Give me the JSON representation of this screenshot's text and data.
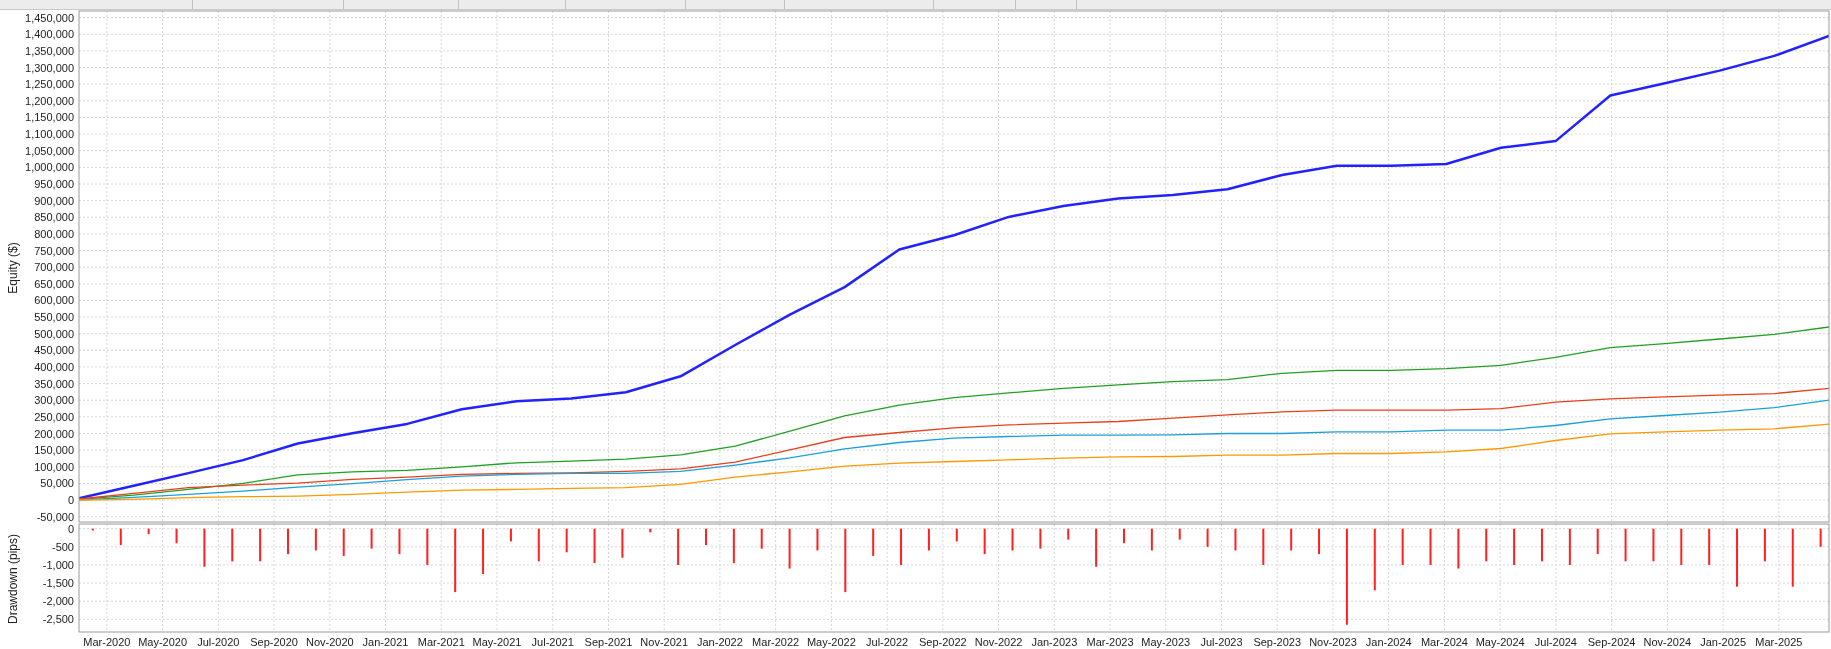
{
  "equity_chart": {
    "chart_data": {
      "type": "line",
      "ylabel": "Equity ($)",
      "categories": [
        null,
        null,
        null,
        null,
        null,
        null,
        null,
        null,
        null,
        null,
        null,
        null,
        null,
        null,
        null,
        null,
        null,
        null,
        null,
        null,
        null,
        null,
        null,
        null,
        null,
        null,
        null,
        null,
        null,
        null,
        null,
        null,
        null
      ],
      "ylim": [
        -66000,
        1470000
      ],
      "grid": true,
      "yticks": [
        {
          "value": 1450000,
          "label": "1,450,000"
        },
        {
          "value": 1400000,
          "label": "1,400,000"
        },
        {
          "value": 1350000,
          "label": "1,350,000"
        },
        {
          "value": 1300000,
          "label": "1,300,000"
        },
        {
          "value": 1250000,
          "label": "1,250,000"
        },
        {
          "value": 1200000,
          "label": "1,200,000"
        },
        {
          "value": 1150000,
          "label": "1,150,000"
        },
        {
          "value": 1100000,
          "label": "1,100,000"
        },
        {
          "value": 1050000,
          "label": "1,050,000"
        },
        {
          "value": 1000000,
          "label": "1,000,000"
        },
        {
          "value": 950000,
          "label": "950,000"
        },
        {
          "value": 900000,
          "label": "900,000"
        },
        {
          "value": 850000,
          "label": "850,000"
        },
        {
          "value": 800000,
          "label": "800,000"
        },
        {
          "value": 750000,
          "label": "750,000"
        },
        {
          "value": 700000,
          "label": "700,000"
        },
        {
          "value": 650000,
          "label": "650,000"
        },
        {
          "value": 600000,
          "label": "600,000"
        },
        {
          "value": 550000,
          "label": "550,000"
        },
        {
          "value": 500000,
          "label": "500,000"
        },
        {
          "value": 450000,
          "label": "450,000"
        },
        {
          "value": 400000,
          "label": "400,000"
        },
        {
          "value": 350000,
          "label": "350,000"
        },
        {
          "value": 300000,
          "label": "300,000"
        },
        {
          "value": 250000,
          "label": "250,000"
        },
        {
          "value": 200000,
          "label": "200,000"
        },
        {
          "value": 150000,
          "label": "150,000"
        },
        {
          "value": 100000,
          "label": "100,000"
        },
        {
          "value": 50000,
          "label": "50,000"
        },
        {
          "value": 0,
          "label": "0"
        },
        {
          "value": -50000,
          "label": "-50,000"
        }
      ],
      "series": [
        {
          "color": "#2222ff",
          "values": [
            5000,
            43000,
            81000,
            120000,
            170000,
            201000,
            229000,
            273000,
            297000,
            305000,
            324000,
            372000,
            466000,
            557000,
            640000,
            753000,
            796000,
            851000,
            884000,
            906000,
            917000,
            934000,
            977000,
            1005000,
            1005000,
            1010000,
            1059000,
            1079000,
            1216000,
            1253000,
            1291000,
            1335000,
            1395000
          ]
        },
        {
          "color": "#22a022",
          "values": [
            2000,
            15000,
            32000,
            50000,
            76000,
            85000,
            89000,
            100000,
            112000,
            117000,
            123000,
            136000,
            162000,
            207000,
            253000,
            285000,
            308000,
            322000,
            336000,
            346000,
            356000,
            362000,
            381000,
            390000,
            390000,
            395000,
            405000,
            429000,
            458000,
            470000,
            484000,
            498000,
            520000
          ]
        },
        {
          "color": "#e8401c",
          "values": [
            3000,
            20000,
            37000,
            45000,
            51000,
            62000,
            69000,
            77000,
            80000,
            82000,
            86000,
            94000,
            114000,
            151000,
            188000,
            203000,
            217000,
            226000,
            231000,
            236000,
            246000,
            256000,
            265000,
            270000,
            270000,
            270000,
            275000,
            294000,
            304000,
            310000,
            315000,
            320000,
            336000
          ]
        },
        {
          "color": "#1aa0d8",
          "values": [
            0,
            8000,
            17000,
            27000,
            39000,
            49000,
            61000,
            72000,
            77000,
            80000,
            80000,
            86000,
            105000,
            127000,
            154000,
            173000,
            186000,
            191000,
            195000,
            195000,
            196000,
            200000,
            200000,
            205000,
            205000,
            210000,
            210000,
            224000,
            244000,
            254000,
            264000,
            278000,
            300000
          ]
        },
        {
          "color": "#ff9900",
          "values": [
            0,
            2000,
            7000,
            10000,
            12000,
            17000,
            24000,
            30000,
            32000,
            35000,
            37000,
            47000,
            69000,
            85000,
            102000,
            111000,
            116000,
            121000,
            126000,
            130000,
            131000,
            135000,
            135000,
            140000,
            140000,
            145000,
            155000,
            179000,
            199000,
            205000,
            210000,
            214000,
            228000
          ]
        }
      ]
    }
  },
  "drawdown_chart": {
    "chart_data": {
      "type": "bar",
      "ylabel": "Drawdown (pips)",
      "categories": [
        null,
        "Mar-2020",
        null,
        "May-2020",
        null,
        "Jul-2020",
        null,
        "Sep-2020",
        null,
        "Nov-2020",
        null,
        "Jan-2021",
        null,
        "Mar-2021",
        null,
        "May-2021",
        null,
        "Jul-2021",
        null,
        "Sep-2021",
        null,
        "Nov-2021",
        null,
        "Jan-2022",
        null,
        "Mar-2022",
        null,
        "May-2022",
        null,
        "Jul-2022",
        null,
        "Sep-2022",
        null,
        "Nov-2022",
        null,
        "Jan-2023",
        null,
        "Mar-2023",
        null,
        "May-2023",
        null,
        "Jul-2023",
        null,
        "Sep-2023",
        null,
        "Nov-2023",
        null,
        "Jan-2024",
        null,
        "Mar-2024",
        null,
        "May-2024",
        null,
        "Jul-2024",
        null,
        "Sep-2024",
        null,
        "Nov-2024",
        null,
        "Jan-2025",
        null,
        "Mar-2025",
        null
      ],
      "values": [
        -50,
        -450,
        -150,
        -400,
        -1050,
        -900,
        -900,
        -700,
        -600,
        -750,
        -550,
        -700,
        -1000,
        -1750,
        -1250,
        -350,
        -900,
        -650,
        -950,
        -800,
        -100,
        -1000,
        -450,
        -950,
        -550,
        -1100,
        -600,
        -1750,
        -750,
        -1000,
        -600,
        -350,
        -700,
        -600,
        -550,
        -300,
        -1050,
        -400,
        -600,
        -300,
        -500,
        -600,
        -1000,
        -600,
        -700,
        -2650,
        -1700,
        -1000,
        -1000,
        -1100,
        -900,
        -1000,
        -900,
        -1000,
        -700,
        -900,
        -900,
        -1000,
        -1000,
        -1600,
        -900,
        -1600,
        -500
      ],
      "ylim": [
        -2850,
        130
      ],
      "grid": true,
      "yticks": [
        {
          "value": 0,
          "label": "0"
        },
        {
          "value": -500,
          "label": "-500"
        },
        {
          "value": -1000,
          "label": "-1,000"
        },
        {
          "value": -1500,
          "label": "-1,500"
        },
        {
          "value": -2000,
          "label": "-2,000"
        },
        {
          "value": -2500,
          "label": "-2,500"
        }
      ]
    }
  }
}
